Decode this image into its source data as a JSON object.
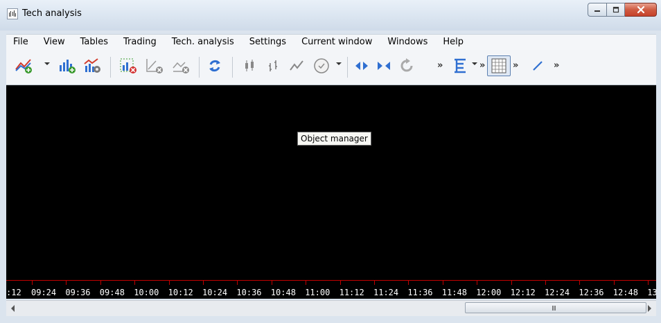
{
  "window": {
    "title": "Tech analysis"
  },
  "menu": [
    "File",
    "View",
    "Tables",
    "Trading",
    "Tech. analysis",
    "Settings",
    "Current window",
    "Windows",
    "Help"
  ],
  "toolbar": {
    "icons": [
      "new-chart-icon",
      "add-bars-icon",
      "chart-settings-icon",
      "delete-chart-icon",
      "delete-line-icon",
      "delete-indicator-icon",
      "refresh-icon",
      "candles-icon",
      "bars-icon",
      "line-icon",
      "timeframe-clock-icon",
      "scroll-left-right-icon",
      "fit-icon",
      "reset-icon",
      "more-icon",
      "template-icon",
      "grid-icon",
      "draw-line-icon"
    ],
    "overflow_glyph": "»"
  },
  "tooltip": "Object manager",
  "time_axis": {
    "labels": [
      ":12",
      "09:24",
      "09:36",
      "09:48",
      "10:00",
      "10:12",
      "10:24",
      "10:36",
      "10:48",
      "11:00",
      "11:12",
      "11:24",
      "11:36",
      "11:48",
      "12:00",
      "12:12",
      "12:24",
      "12:36",
      "12:48",
      "13"
    ]
  },
  "scrollbar": {
    "grip": "III"
  },
  "colors": {
    "chart_bg": "#000000",
    "axis": "#c20000",
    "axis_text": "#ffffff"
  }
}
